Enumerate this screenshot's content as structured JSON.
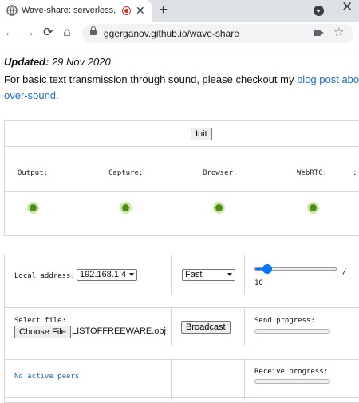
{
  "browser": {
    "tab_title": "Wave-share: serverless, peer-to-peer",
    "tab_close": "✕",
    "new_tab": "+",
    "window_close": "✕",
    "url": "ggerganov.github.io/wave-share",
    "back": "←",
    "forward": "→",
    "reload": "⟳",
    "home": "⌂",
    "star": "☆"
  },
  "intro": {
    "updated_label": "Updated:",
    "updated_date": " 29 Nov 2020",
    "text": "For basic text transmission through sound, please checkout my ",
    "link_text": "blog post about",
    "link_text_2": "over-sound",
    "trailing": "."
  },
  "controls": {
    "init_label": "Init",
    "status": [
      {
        "label": "Output:",
        "state": "ok"
      },
      {
        "label": "Capture:",
        "state": "ok"
      },
      {
        "label": "Browser:",
        "state": "ok"
      },
      {
        "label": "WebRTC:",
        "state": "ok"
      }
    ],
    "status_extra": ":"
  },
  "transfer": {
    "local_address_label": "Local address:",
    "local_address_value": "192.168.1.4",
    "speed_value": "Fast",
    "volume_value": "10",
    "volume_fraction": 0.1,
    "slash": "/",
    "select_file_label": "Select file:",
    "choose_file_label": "Choose File",
    "file_name": "LISTOFFREEWARE.obj",
    "broadcast_label": "Broadcast",
    "send_progress_label": "Send progress:",
    "send_progress": 0,
    "receive_progress_label": "Receive progress:",
    "receive_progress": 0,
    "peers_text": "No active peers"
  },
  "colors": {
    "link": "#1a6fc4",
    "status_ok": "#4b8f17",
    "accent": "#0075ff"
  }
}
